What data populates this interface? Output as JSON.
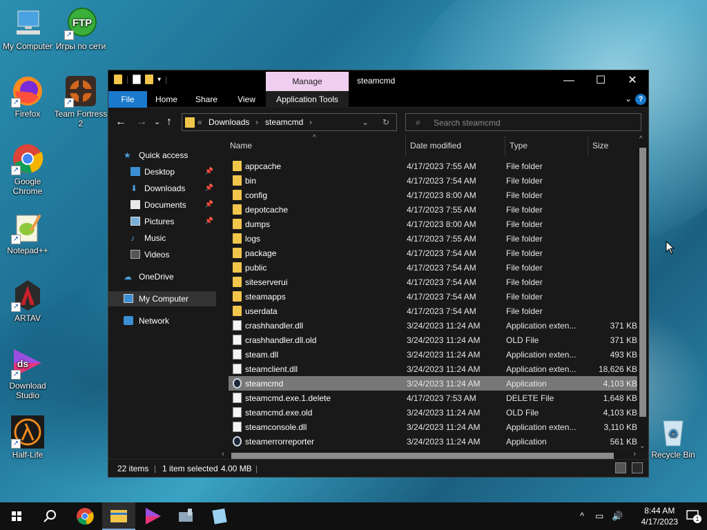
{
  "desktop": {
    "icons": [
      {
        "label": "My Computer"
      },
      {
        "label": "Игры по сети",
        "badge": "FTP"
      },
      {
        "label": "Firefox"
      },
      {
        "label": "Team Fortress 2"
      },
      {
        "label": "Google Chrome"
      },
      {
        "label": "Notepad++"
      },
      {
        "label": "ARTAV"
      },
      {
        "label": "Download Studio",
        "badge": "ds"
      },
      {
        "label": "Half-Life"
      },
      {
        "label": "Recycle Bin"
      }
    ]
  },
  "window": {
    "title": "steamcmd",
    "manage_tab": "Manage",
    "ribbon_tabs": [
      "File",
      "Home",
      "Share",
      "View",
      "Application Tools"
    ],
    "address": {
      "overflow": "«",
      "crumbs": [
        "Downloads",
        "steamcmd"
      ]
    },
    "search_placeholder": "Search steamcmd",
    "nav": [
      {
        "label": "Quick access",
        "icon": "star-icon"
      },
      {
        "label": "Desktop",
        "icon": "desktop-icon",
        "pinned": true
      },
      {
        "label": "Downloads",
        "icon": "download-icon",
        "pinned": true
      },
      {
        "label": "Documents",
        "icon": "documents-icon",
        "pinned": true
      },
      {
        "label": "Pictures",
        "icon": "pictures-icon",
        "pinned": true
      },
      {
        "label": "Music",
        "icon": "music-icon"
      },
      {
        "label": "Videos",
        "icon": "videos-icon"
      },
      {
        "label": "OneDrive",
        "icon": "cloud-icon"
      },
      {
        "label": "My Computer",
        "icon": "computer-icon",
        "selected": true
      },
      {
        "label": "Network",
        "icon": "network-icon"
      }
    ],
    "columns": {
      "name": "Name",
      "date": "Date modified",
      "type": "Type",
      "size": "Size"
    },
    "files": [
      {
        "name": "appcache",
        "date": "4/17/2023 7:55 AM",
        "type": "File folder",
        "size": "",
        "kind": "folder"
      },
      {
        "name": "bin",
        "date": "4/17/2023 7:54 AM",
        "type": "File folder",
        "size": "",
        "kind": "folder"
      },
      {
        "name": "config",
        "date": "4/17/2023 8:00 AM",
        "type": "File folder",
        "size": "",
        "kind": "folder"
      },
      {
        "name": "depotcache",
        "date": "4/17/2023 7:55 AM",
        "type": "File folder",
        "size": "",
        "kind": "folder"
      },
      {
        "name": "dumps",
        "date": "4/17/2023 8:00 AM",
        "type": "File folder",
        "size": "",
        "kind": "folder"
      },
      {
        "name": "logs",
        "date": "4/17/2023 7:55 AM",
        "type": "File folder",
        "size": "",
        "kind": "folder"
      },
      {
        "name": "package",
        "date": "4/17/2023 7:54 AM",
        "type": "File folder",
        "size": "",
        "kind": "folder"
      },
      {
        "name": "public",
        "date": "4/17/2023 7:54 AM",
        "type": "File folder",
        "size": "",
        "kind": "folder"
      },
      {
        "name": "siteserverui",
        "date": "4/17/2023 7:54 AM",
        "type": "File folder",
        "size": "",
        "kind": "folder"
      },
      {
        "name": "steamapps",
        "date": "4/17/2023 7:54 AM",
        "type": "File folder",
        "size": "",
        "kind": "folder"
      },
      {
        "name": "userdata",
        "date": "4/17/2023 7:54 AM",
        "type": "File folder",
        "size": "",
        "kind": "folder"
      },
      {
        "name": "crashhandler.dll",
        "date": "3/24/2023 11:24 AM",
        "type": "Application exten...",
        "size": "371 KB",
        "kind": "dll"
      },
      {
        "name": "crashhandler.dll.old",
        "date": "3/24/2023 11:24 AM",
        "type": "OLD File",
        "size": "371 KB",
        "kind": "doc"
      },
      {
        "name": "steam.dll",
        "date": "3/24/2023 11:24 AM",
        "type": "Application exten...",
        "size": "493 KB",
        "kind": "dll"
      },
      {
        "name": "steamclient.dll",
        "date": "3/24/2023 11:24 AM",
        "type": "Application exten...",
        "size": "18,626 KB",
        "kind": "dll"
      },
      {
        "name": "steamcmd",
        "date": "3/24/2023 11:24 AM",
        "type": "Application",
        "size": "4,103 KB",
        "kind": "app",
        "selected": true
      },
      {
        "name": "steamcmd.exe.1.delete",
        "date": "4/17/2023 7:53 AM",
        "type": "DELETE File",
        "size": "1,648 KB",
        "kind": "doc"
      },
      {
        "name": "steamcmd.exe.old",
        "date": "3/24/2023 11:24 AM",
        "type": "OLD File",
        "size": "4,103 KB",
        "kind": "doc"
      },
      {
        "name": "steamconsole.dll",
        "date": "3/24/2023 11:24 AM",
        "type": "Application exten...",
        "size": "3,110 KB",
        "kind": "dll"
      },
      {
        "name": "steamerrorreporter",
        "date": "3/24/2023 11:24 AM",
        "type": "Application",
        "size": "561 KB",
        "kind": "app"
      }
    ],
    "status": {
      "items": "22 items",
      "selected": "1 item selected",
      "size": "4.00 MB"
    }
  },
  "taskbar": {
    "time": "8:44 AM",
    "date": "4/17/2023",
    "notification_count": "1",
    "apps": [
      "start-icon",
      "search-icon",
      "chrome-icon",
      "file-explorer-icon",
      "download-studio-icon",
      "tool-icon",
      "notepad-icon"
    ]
  }
}
